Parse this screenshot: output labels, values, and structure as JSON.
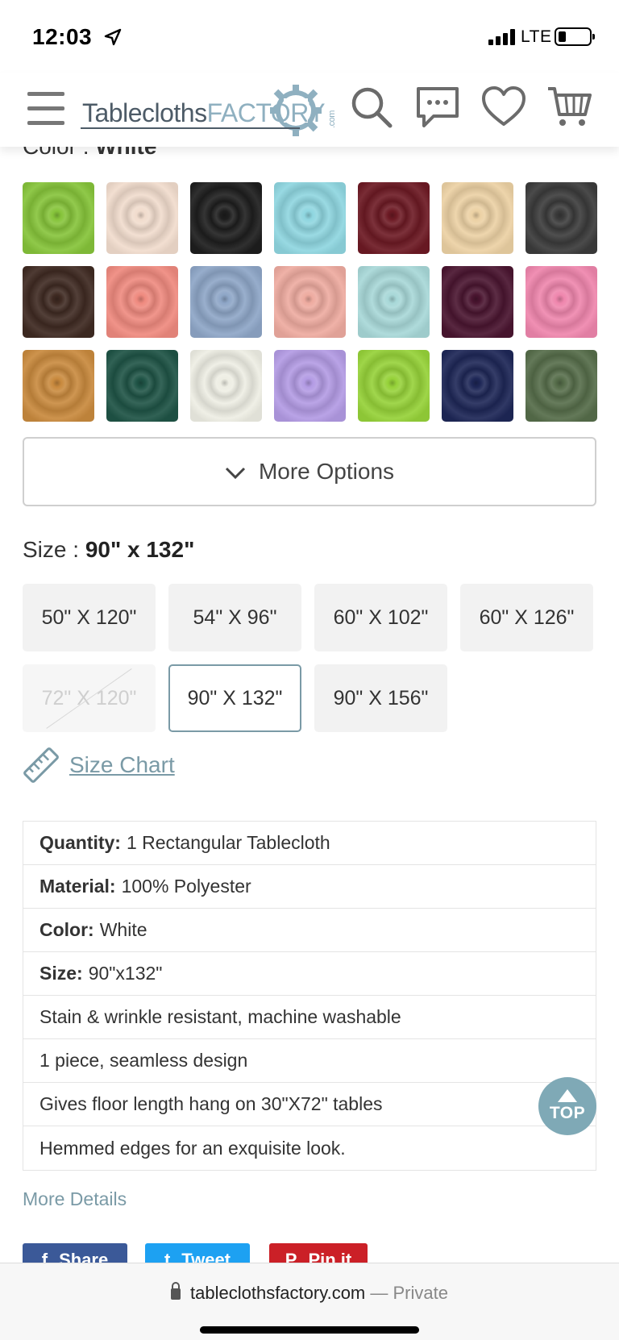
{
  "status_bar": {
    "time": "12:03",
    "network": "LTE"
  },
  "header": {
    "logo_part1": "Tablecloths",
    "logo_part2": "FACTORY",
    "logo_suffix": ".com",
    "icons": [
      "menu-icon",
      "search-icon",
      "chat-icon",
      "heart-icon",
      "cart-icon"
    ]
  },
  "color": {
    "label": "Color : ",
    "selected": "White",
    "swatches": [
      {
        "name": "lime",
        "hex": "#86c43a"
      },
      {
        "name": "blush",
        "hex": "#f1dccd"
      },
      {
        "name": "black",
        "hex": "#1e1e1e"
      },
      {
        "name": "aqua",
        "hex": "#8fd6e0"
      },
      {
        "name": "burgundy",
        "hex": "#6d1a24"
      },
      {
        "name": "champagne",
        "hex": "#ecd1a4"
      },
      {
        "name": "charcoal",
        "hex": "#3b3b3b"
      },
      {
        "name": "chocolate",
        "hex": "#3f2a22"
      },
      {
        "name": "coral",
        "hex": "#ef8a7f"
      },
      {
        "name": "dusty-blue",
        "hex": "#8ea6c7"
      },
      {
        "name": "rose-quartz",
        "hex": "#eeaba0"
      },
      {
        "name": "light-aqua",
        "hex": "#a8d8d8"
      },
      {
        "name": "eggplant",
        "hex": "#4a1530"
      },
      {
        "name": "pink",
        "hex": "#ef86ad"
      },
      {
        "name": "gold",
        "hex": "#c98a3e"
      },
      {
        "name": "hunter-green",
        "hex": "#1f5446"
      },
      {
        "name": "ivory",
        "hex": "#eeeee4"
      },
      {
        "name": "lavender",
        "hex": "#b39be4"
      },
      {
        "name": "apple-green",
        "hex": "#96d239"
      },
      {
        "name": "navy",
        "hex": "#1e2757"
      },
      {
        "name": "sage",
        "hex": "#566d4a"
      }
    ]
  },
  "more_options_label": "More Options",
  "size": {
    "label": "Size : ",
    "selected": "90\" x 132\"",
    "options": [
      {
        "label": "50\" X 120\"",
        "state": "normal"
      },
      {
        "label": "54\" X 96\"",
        "state": "normal"
      },
      {
        "label": "60\" X 102\"",
        "state": "normal"
      },
      {
        "label": "60\" X 126\"",
        "state": "normal"
      },
      {
        "label": "72\" X 120\"",
        "state": "disabled"
      },
      {
        "label": "90\" X 132\"",
        "state": "selected"
      },
      {
        "label": "90\" X 156\"",
        "state": "normal"
      }
    ],
    "chart_link": "Size Chart"
  },
  "specs": [
    {
      "key": "Quantity:",
      "value": "1 Rectangular Tablecloth"
    },
    {
      "key": "Material:",
      "value": "100% Polyester"
    },
    {
      "key": "Color:",
      "value": "White"
    },
    {
      "key": "Size:",
      "value": "90\"x132\""
    },
    {
      "key": "",
      "value": "Stain & wrinkle resistant, machine washable"
    },
    {
      "key": "",
      "value": "1 piece, seamless design"
    },
    {
      "key": "",
      "value": "Gives floor length hang on 30\"X72\" tables"
    },
    {
      "key": "",
      "value": "Hemmed edges for an exquisite look."
    }
  ],
  "top_button_label": "TOP",
  "more_details_label": "More Details",
  "share": [
    {
      "label": "Share",
      "icon": "facebook-icon",
      "glyph": "f",
      "color": "#3b5998"
    },
    {
      "label": "Tweet",
      "icon": "twitter-icon",
      "glyph": "t",
      "color": "#1da1f2"
    },
    {
      "label": "Pin it",
      "icon": "pinterest-icon",
      "glyph": "P",
      "color": "#cb2027"
    }
  ],
  "browser": {
    "url": "tableclothsfactory.com",
    "separator": " — ",
    "mode": "Private"
  },
  "colors": {
    "accent": "#7a9aa6",
    "brand_dark": "#4d5b67",
    "brand_light": "#8fb0c0"
  }
}
